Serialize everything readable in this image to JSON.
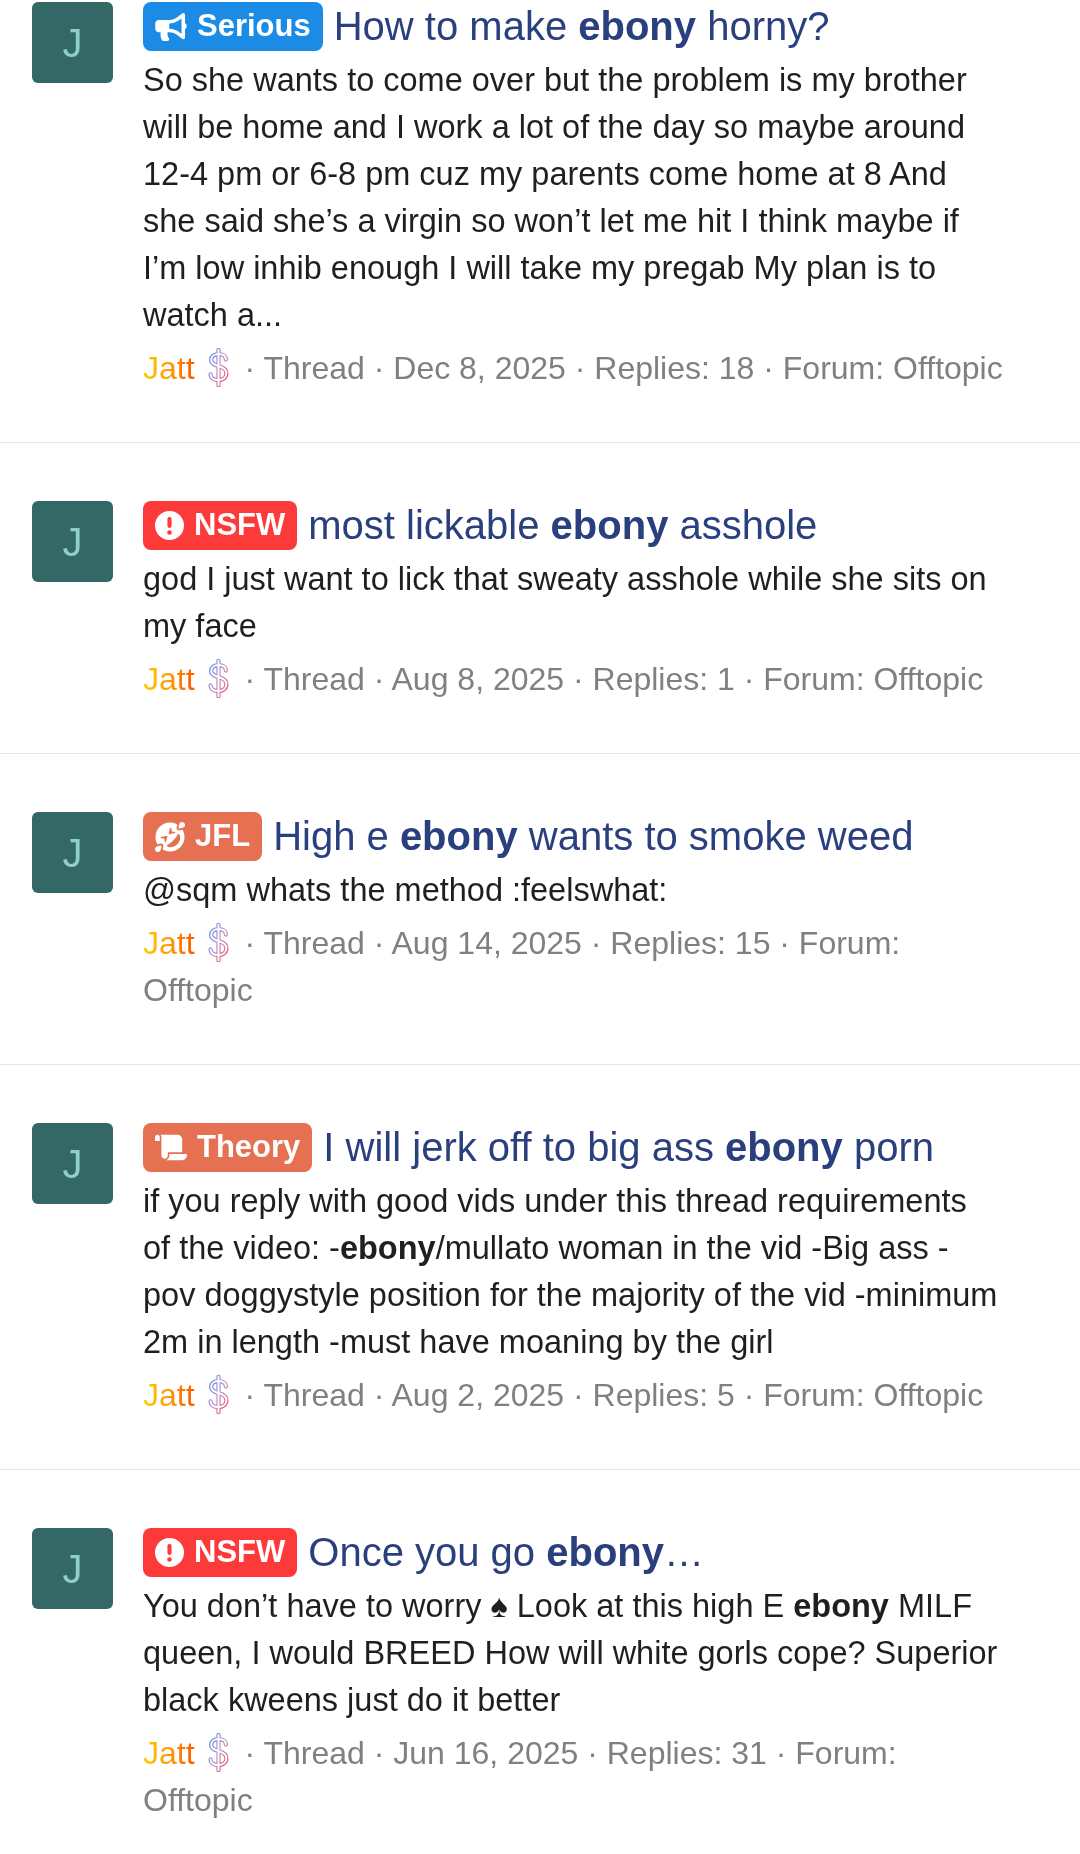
{
  "results": [
    {
      "avatar": {
        "letter": "J"
      },
      "prefix": {
        "kind": "serious",
        "label": "Serious"
      },
      "title": "How to make **ebony** horny?",
      "snippet": "So she wants to come over but the problem is my brother will be home and I work a lot of the day so maybe around 12-4 pm or 6-8 pm cuz my parents come home at 8 And she said she’s a virgin so won’t let me hit I think maybe if I’m low inhib enough I will take my pregab My plan is to watch a...",
      "meta": {
        "author": "Jatt",
        "details": [
          "· Thread",
          "· Dec 8, 2025",
          "· Replies: 18",
          "· Forum:"
        ],
        "forum": "Offtopic"
      }
    },
    {
      "avatar": {
        "letter": "J"
      },
      "prefix": {
        "kind": "nsfw",
        "label": "NSFW"
      },
      "title": "most lickable **ebony** asshole",
      "snippet": "god I just want to lick that sweaty asshole while she sits on my face",
      "meta": {
        "author": "Jatt",
        "details": [
          "· Thread",
          "· Aug 8, 2025",
          "· Replies: 1",
          "· Forum:"
        ],
        "forum": "Offtopic"
      }
    },
    {
      "avatar": {
        "letter": "J"
      },
      "prefix": {
        "kind": "jfl",
        "label": "JFL"
      },
      "title": "High e **ebony** wants to smoke weed",
      "snippet": "@sqm whats the method :feelswhat:",
      "meta": {
        "author": "Jatt",
        "details": [
          "· Thread",
          "· Aug 14, 2025",
          "· Replies: 15",
          "· Forum:"
        ],
        "forum": "Offtopic"
      }
    },
    {
      "avatar": {
        "letter": "J"
      },
      "prefix": {
        "kind": "theory",
        "label": "Theory"
      },
      "title": "I will jerk off to big ass **ebony** porn",
      "snippet": "if you reply with good vids under this thread requirements of the video: -**ebony**/mullato woman in the vid -Big ass -pov doggystyle position for the majority of the vid -minimum 2m in length -must have moaning by the girl",
      "meta": {
        "author": "Jatt",
        "details": [
          "· Thread",
          "· Aug 2, 2025",
          "· Replies: 5",
          "· Forum:"
        ],
        "forum": "Offtopic"
      }
    },
    {
      "avatar": {
        "letter": "J"
      },
      "prefix": {
        "kind": "nsfw",
        "label": "NSFW"
      },
      "title": "Once you go **ebony**…",
      "snippet": "You don’t have to worry ♠ Look at this high E **ebony** MILF queen, I would BREED How will white gorls cope? Superior black kweens just do it better",
      "meta": {
        "author": "Jatt",
        "details": [
          "· Thread",
          "· Jun 16, 2025",
          "· Replies: 31",
          "· Forum:"
        ],
        "forum": "Offtopic"
      }
    }
  ]
}
